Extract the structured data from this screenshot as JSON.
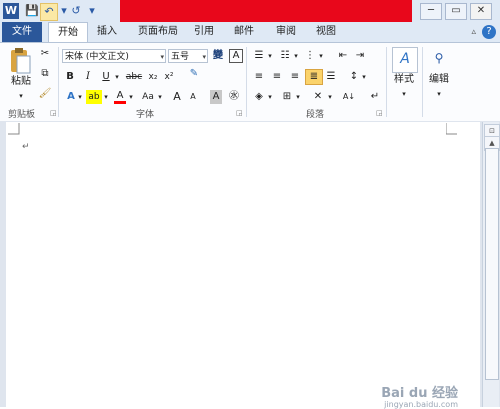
{
  "quick_access": {
    "word_icon": "W",
    "save_icon": "💾",
    "undo_icon": "↶",
    "redo_icon": "↺",
    "customize_icon": "▾"
  },
  "window": {
    "minimize": "─",
    "restore": "▭",
    "close": "✕"
  },
  "tabs": [
    "文件",
    "开始",
    "插入",
    "页面布局",
    "引用",
    "邮件",
    "审阅",
    "视图"
  ],
  "clipboard": {
    "paste_label": "粘贴",
    "group_label": "剪贴板"
  },
  "font": {
    "font_name": "宋体 (中文正文)",
    "font_size": "五号",
    "group_label": "字体",
    "bold": "B",
    "italic": "I",
    "underline": "U",
    "strikethrough": "abc",
    "subscript": "x₂",
    "superscript": "x²",
    "grow_font": "A",
    "shrink_font": "A",
    "change_case": "Aa",
    "clear_format": "A",
    "phonetic": "變",
    "char_border": "A",
    "char_shading": "A",
    "enclose_char": "㊌"
  },
  "paragraph": {
    "group_label": "段落"
  },
  "styles": {
    "label": "样式"
  },
  "editing": {
    "label": "编辑"
  },
  "document": {
    "paragraph_mark": "↵"
  },
  "watermark": {
    "text": "Bai du 经验",
    "sub": "jingyan.baidu.com"
  },
  "colors": {
    "file_tab": "#2b579a",
    "title_bar_redaction": "#e8071b",
    "ribbon_bg": "#fbfcfe",
    "highlight_yellow": "#ffff00",
    "font_color_red": "#ff0000"
  }
}
